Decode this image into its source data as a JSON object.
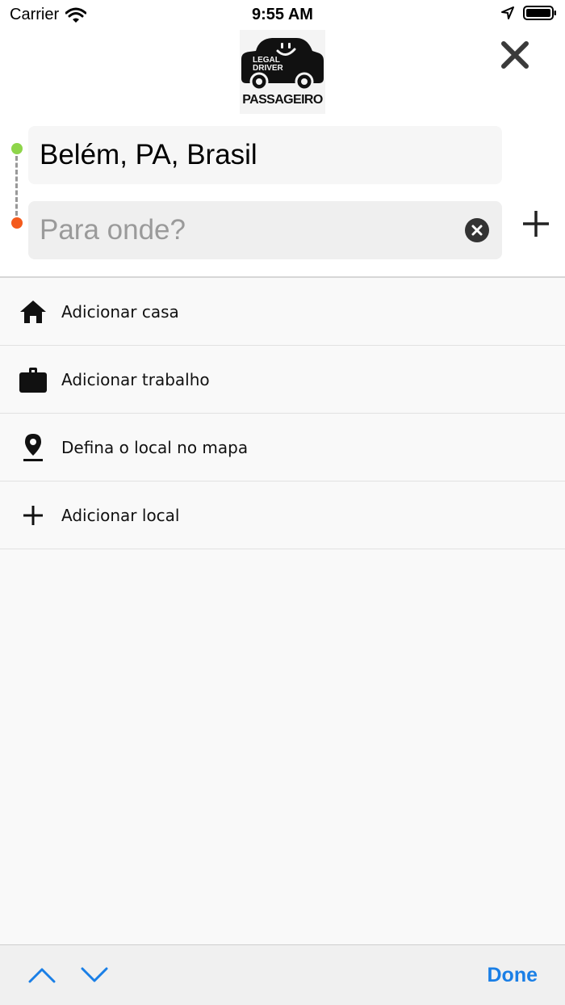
{
  "status_bar": {
    "carrier": "Carrier",
    "time": "9:55 AM"
  },
  "header": {
    "logo": {
      "badge_line1": "LEGAL",
      "badge_line2": "DRIVER",
      "caption": "PASSAGEIRO"
    }
  },
  "route": {
    "origin": "Belém, PA, Brasil",
    "destination_value": "",
    "destination_placeholder": "Para onde?"
  },
  "shortcuts": [
    {
      "label": "Adicionar casa",
      "icon": "home-icon"
    },
    {
      "label": "Adicionar trabalho",
      "icon": "briefcase-icon"
    },
    {
      "label": "Defina o local no mapa",
      "icon": "map-pin-icon"
    },
    {
      "label": "Adicionar local",
      "icon": "plus-icon"
    }
  ],
  "keyboard_toolbar": {
    "done_label": "Done"
  },
  "colors": {
    "origin_dot": "#8ed54a",
    "destination_dot": "#f45a1c",
    "accent": "#1a7fe6"
  }
}
